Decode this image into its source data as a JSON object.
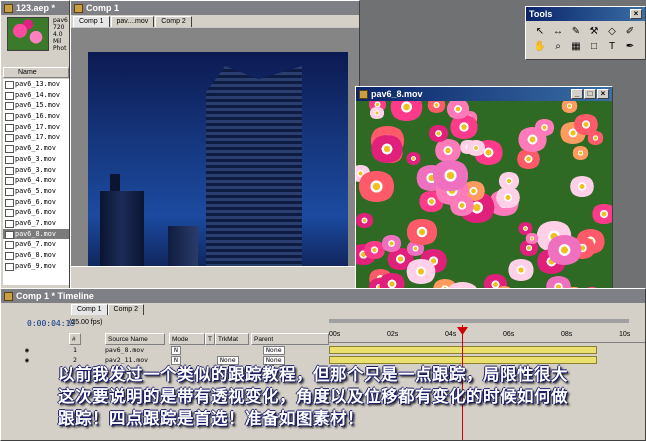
{
  "project": {
    "title": "123.aep *",
    "info_lines": [
      "pav6",
      "720",
      "4.0",
      "Mil",
      "Phot"
    ],
    "column_name": "Name",
    "items": [
      "pav6_13.mov",
      "pav6_14.mov",
      "pav6_15.mov",
      "pav6_16.mov",
      "pav6_17.mov",
      "pav6_17.mov",
      "pav6_2.mov",
      "pav6_3.mov",
      "pav6_3.mov",
      "pav6_4.mov",
      "pav6_5.mov",
      "pav6_6.mov",
      "pav6_6.mov",
      "pav6_7.mov",
      "pav6_8.mov",
      "pav6_7.mov",
      "pav6_8.mov",
      "pav6_9.mov"
    ],
    "selected_index": 14
  },
  "comp": {
    "title": "Comp 1",
    "tabs": [
      "Comp 1",
      "pav....mov",
      "Comp 2"
    ]
  },
  "tools": {
    "title": "Tools",
    "icons": [
      "↖",
      "↔",
      "✎",
      "⚒",
      "◇",
      "✐",
      "✋",
      "⌕",
      "▦",
      "□",
      "T",
      "✒"
    ]
  },
  "footage": {
    "title": "pav6_8.mov"
  },
  "timeline": {
    "title": "Comp 1 * Timeline",
    "tabs": [
      "Comp 1",
      "Comp 2"
    ],
    "timecode": "0:00:04:19",
    "fps": "(25.00 fps)",
    "columns": [
      "#",
      "Source Name",
      "Mode",
      "T",
      "TrkMat",
      "Parent"
    ],
    "layers": [
      {
        "num": "1",
        "name": "pav6_8.mov",
        "mode": "N",
        "trkmat": "",
        "parent": "None"
      },
      {
        "num": "2",
        "name": "pav2_11.mov",
        "mode": "N",
        "trkmat": "None",
        "parent": "None"
      }
    ],
    "ruler": [
      "00s",
      "02s",
      "04s",
      "06s",
      "08s",
      "10s"
    ]
  },
  "caption": {
    "lines": [
      "以前我发过一个类似的跟踪教程，但那个只是一点跟踪，局限性很大",
      "这次要说明的是带有透视变化，角度以及位移都有变化的时候如何做",
      "跟踪！四点跟踪是首选！准备如图素材！"
    ]
  }
}
